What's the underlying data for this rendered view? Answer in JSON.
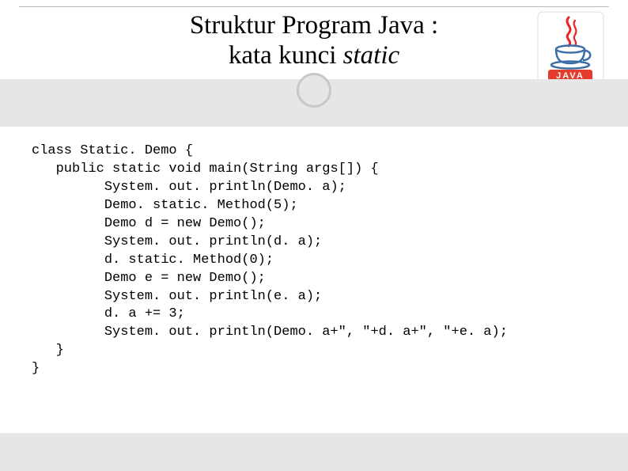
{
  "title": {
    "line1": "Struktur Program Java :",
    "line2_plain": "kata kunci ",
    "line2_italic": "static"
  },
  "logo": {
    "name": "java-logo"
  },
  "code": {
    "lines": [
      "class Static. Demo {",
      "   public static void main(String args[]) {",
      "         System. out. println(Demo. a);",
      "         Demo. static. Method(5);",
      "         Demo d = new Demo();",
      "         System. out. println(d. a);",
      "         d. static. Method(0);",
      "         Demo e = new Demo();",
      "         System. out. println(e. a);",
      "         d. a += 3;",
      "         System. out. println(Demo. a+\", \"+d. a+\", \"+e. a);",
      "   }",
      "}"
    ]
  }
}
